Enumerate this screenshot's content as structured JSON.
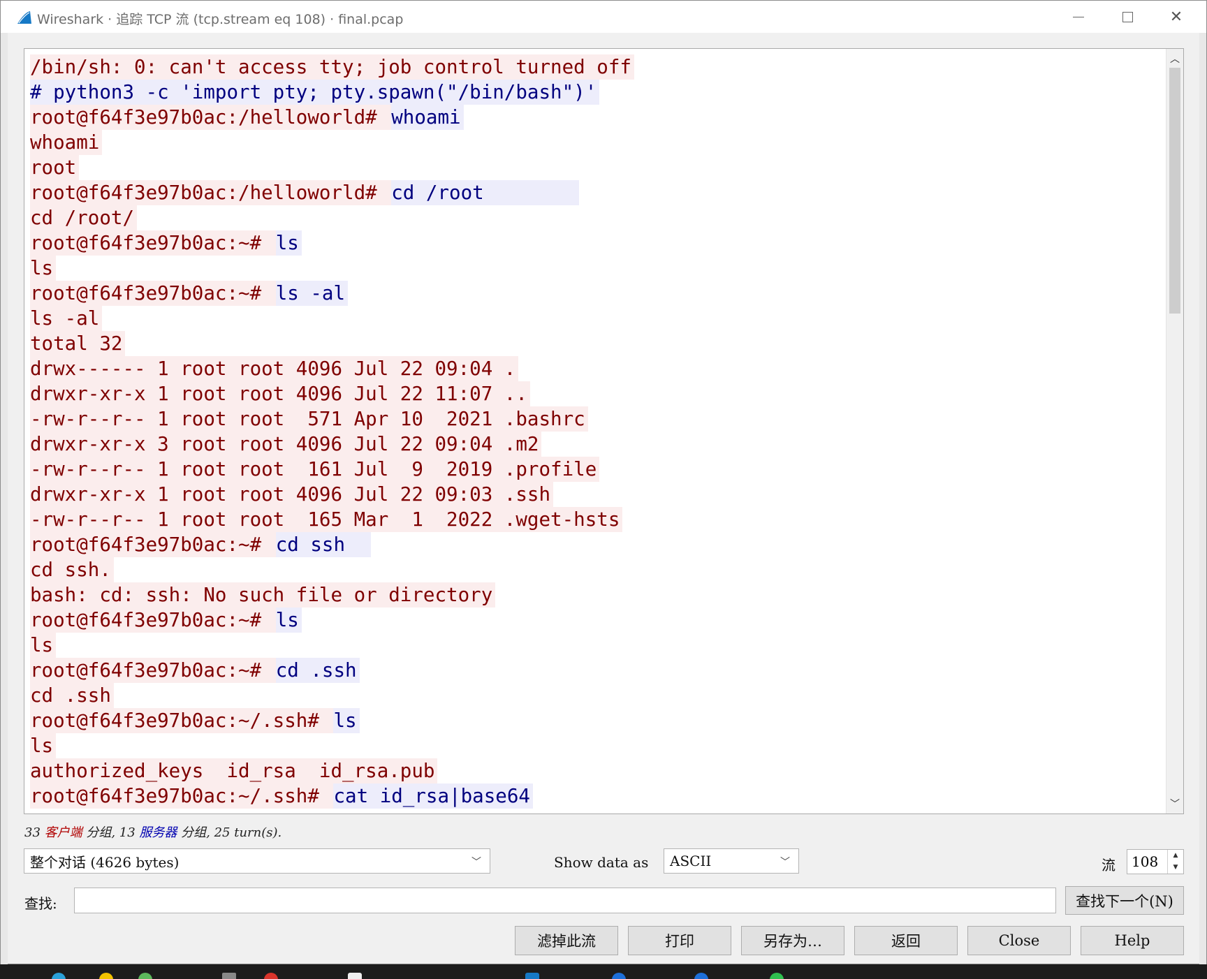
{
  "window": {
    "title": "Wireshark · 追踪 TCP 流 (tcp.stream eq 108) · final.pcap"
  },
  "stream": {
    "lines": [
      {
        "text": "/bin/sh: 0: can't access tty; job control turned off",
        "dir": "client"
      },
      {
        "text": "# python3 -c 'import pty; pty.spawn(\"/bin/bash\")'",
        "dir": "server"
      },
      {
        "text": "root@f64f3e97b0ac:/helloworld# ",
        "dir": "client",
        "tail": "whoami",
        "tail_dir": "server"
      },
      {
        "text": "whoami",
        "dir": "client"
      },
      {
        "text": "root",
        "dir": "client"
      },
      {
        "text": "root@f64f3e97b0ac:/helloworld# ",
        "dir": "client",
        "tail": "cd /root        ",
        "tail_dir": "server"
      },
      {
        "text": "cd /root/",
        "dir": "client"
      },
      {
        "text": "root@f64f3e97b0ac:~# ",
        "dir": "client",
        "tail": "ls",
        "tail_dir": "server"
      },
      {
        "text": "ls",
        "dir": "client"
      },
      {
        "text": "root@f64f3e97b0ac:~# ",
        "dir": "client",
        "tail": "ls -al",
        "tail_dir": "server"
      },
      {
        "text": "ls -al",
        "dir": "client"
      },
      {
        "text": "total 32",
        "dir": "client"
      },
      {
        "text": "drwx------ 1 root root 4096 Jul 22 09:04 .",
        "dir": "client"
      },
      {
        "text": "drwxr-xr-x 1 root root 4096 Jul 22 11:07 ..",
        "dir": "client"
      },
      {
        "text": "-rw-r--r-- 1 root root  571 Apr 10  2021 .bashrc",
        "dir": "client"
      },
      {
        "text": "drwxr-xr-x 3 root root 4096 Jul 22 09:04 .m2",
        "dir": "client"
      },
      {
        "text": "-rw-r--r-- 1 root root  161 Jul  9  2019 .profile",
        "dir": "client"
      },
      {
        "text": "drwxr-xr-x 1 root root 4096 Jul 22 09:03 .ssh",
        "dir": "client"
      },
      {
        "text": "-rw-r--r-- 1 root root  165 Mar  1  2022 .wget-hsts",
        "dir": "client"
      },
      {
        "text": "root@f64f3e97b0ac:~# ",
        "dir": "client",
        "tail": "cd ssh  ",
        "tail_dir": "server"
      },
      {
        "text": "cd ssh.",
        "dir": "client"
      },
      {
        "text": "bash: cd: ssh: No such file or directory",
        "dir": "client"
      },
      {
        "text": "root@f64f3e97b0ac:~# ",
        "dir": "client",
        "tail": "ls",
        "tail_dir": "server"
      },
      {
        "text": "ls",
        "dir": "client"
      },
      {
        "text": "root@f64f3e97b0ac:~# ",
        "dir": "client",
        "tail": "cd .ssh",
        "tail_dir": "server"
      },
      {
        "text": "cd .ssh",
        "dir": "client"
      },
      {
        "text": "root@f64f3e97b0ac:~/.ssh# ",
        "dir": "client",
        "tail": "ls",
        "tail_dir": "server"
      },
      {
        "text": "ls",
        "dir": "client"
      },
      {
        "text": "authorized_keys  id_rsa  id_rsa.pub",
        "dir": "client"
      },
      {
        "text": "root@f64f3e97b0ac:~/.ssh# ",
        "dir": "client",
        "tail": "cat id_rsa|base64",
        "tail_dir": "server"
      }
    ]
  },
  "stats": {
    "count_a": "33 ",
    "client_label": "客户端",
    "mid": " 分组, 13 ",
    "server_label": "服务器",
    "end": " 分组, 25 turn(s)."
  },
  "controls": {
    "conversation_select": "整个对话 (4626 bytes)",
    "show_data_as_label": "Show data as",
    "show_data_as_value": "ASCII",
    "stream_label": "流",
    "stream_value": "108",
    "find_label": "查找:",
    "find_value": "",
    "find_next_button": "查找下一个(N)"
  },
  "buttons": {
    "filter_out": "滤掉此流",
    "print": "打印",
    "save_as": "另存为…",
    "back": "返回",
    "close": "Close",
    "help": "Help"
  },
  "colors": {
    "client_bg": "#fbeded",
    "client_fg": "#7f0000",
    "server_bg": "#ededfb",
    "server_fg": "#00007f"
  }
}
